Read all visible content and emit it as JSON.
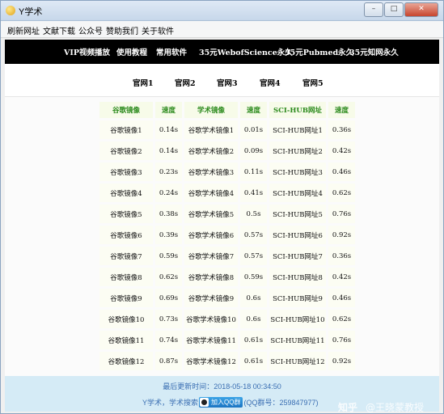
{
  "window": {
    "title": "Y学术"
  },
  "menu": [
    "刷新网址",
    "文献下载",
    "公众号",
    "赞助我们",
    "关于软件"
  ],
  "topnav": [
    "VIP视频播放",
    "使用教程",
    "常用软件",
    "35元WebofScience永久",
    "35元Pubmed永久",
    "35元知网永久"
  ],
  "sitenav": [
    "官网1",
    "官网2",
    "官网3",
    "官网4",
    "官网5"
  ],
  "table": {
    "headers": [
      "谷歌镜像",
      "速度",
      "学术镜像",
      "速度",
      "SCI-HUB网址",
      "速度"
    ],
    "rows": [
      [
        "谷歌镜像1",
        "0.14s",
        "谷歌学术镜像1",
        "0.01s",
        "SCI-HUB网址1",
        "0.36s"
      ],
      [
        "谷歌镜像2",
        "0.14s",
        "谷歌学术镜像2",
        "0.09s",
        "SCI-HUB网址2",
        "0.42s"
      ],
      [
        "谷歌镜像3",
        "0.23s",
        "谷歌学术镜像3",
        "0.11s",
        "SCI-HUB网址3",
        "0.46s"
      ],
      [
        "谷歌镜像4",
        "0.24s",
        "谷歌学术镜像4",
        "0.41s",
        "SCI-HUB网址4",
        "0.62s"
      ],
      [
        "谷歌镜像5",
        "0.38s",
        "谷歌学术镜像5",
        "0.5s",
        "SCI-HUB网址5",
        "0.76s"
      ],
      [
        "谷歌镜像6",
        "0.39s",
        "谷歌学术镜像6",
        "0.57s",
        "SCI-HUB网址6",
        "0.92s"
      ],
      [
        "谷歌镜像7",
        "0.59s",
        "谷歌学术镜像7",
        "0.57s",
        "SCI-HUB网址7",
        "0.36s"
      ],
      [
        "谷歌镜像8",
        "0.62s",
        "谷歌学术镜像8",
        "0.59s",
        "SCI-HUB网址8",
        "0.42s"
      ],
      [
        "谷歌镜像9",
        "0.69s",
        "谷歌学术镜像9",
        "0.6s",
        "SCI-HUB网址9",
        "0.46s"
      ],
      [
        "谷歌镜像10",
        "0.73s",
        "谷歌学术镜像10",
        "0.6s",
        "SCI-HUB网址10",
        "0.62s"
      ],
      [
        "谷歌镜像11",
        "0.74s",
        "谷歌学术镜像11",
        "0.61s",
        "SCI-HUB网址11",
        "0.76s"
      ],
      [
        "谷歌镜像12",
        "0.87s",
        "谷歌学术镜像12",
        "0.61s",
        "SCI-HUB网址12",
        "0.92s"
      ]
    ]
  },
  "footer": {
    "updated": "最后更新时间：2018-05-18 00:34:50",
    "line2_prefix": "Y学术，学术搜索",
    "qq_button": "加入QQ群",
    "line2_suffix": "(QQ群号：259847977)"
  },
  "watermark": {
    "logo": "知乎",
    "handle": "@王晓蒙教授"
  },
  "icons": {
    "app": "app-logo-icon",
    "minimize": "minimize-icon",
    "maximize": "maximize-icon",
    "close": "close-icon",
    "qq": "qq-icon"
  },
  "colors": {
    "header_green": "#2b8a1c",
    "nav_black": "#000000",
    "footer_bg": "#d5ebf6",
    "footer_text": "#3b6fb3"
  }
}
